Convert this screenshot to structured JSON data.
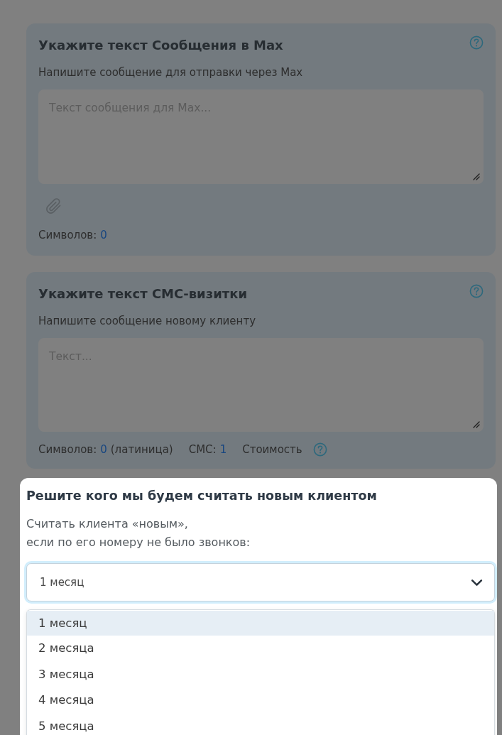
{
  "message_cards": [
    {
      "kind": "attachment",
      "highlighted": false,
      "title": "Укажите текст Сообщения в Max",
      "subtitle": "Напишите сообщение для отправки через Max",
      "textarea": {
        "placeholder": "Текст сообщения для Max..."
      },
      "counters": [
        {
          "label": "Символов:",
          "value": "0"
        }
      ]
    },
    {
      "kind": "sms",
      "highlighted": false,
      "title": "Укажите текст СМС-визитки",
      "subtitle": "Напишите сообщение новому клиенту",
      "textarea": {
        "placeholder": "Текст..."
      },
      "counters": [
        {
          "label": "Символов:",
          "value": "0",
          "note": "(латиница)"
        },
        {
          "label": "СМС:",
          "value": "1"
        }
      ],
      "cost_label": "Стоимость"
    }
  ],
  "new_client_panel": {
    "highlighted": true,
    "title": "Решите кого мы будем считать новым клиентом",
    "description_lines": [
      "Считать клиента «новым»,",
      "если по его номеру не было звонков:"
    ],
    "select": {
      "value": "1 месяц",
      "expanded": true
    },
    "options": [
      {
        "label": "1 месяц",
        "selected": true
      },
      {
        "label": "2 месяца",
        "selected": false
      },
      {
        "label": "3 месяца",
        "selected": false
      },
      {
        "label": "4 месяца",
        "selected": false
      },
      {
        "label": "5 месяца",
        "selected": false
      }
    ]
  }
}
